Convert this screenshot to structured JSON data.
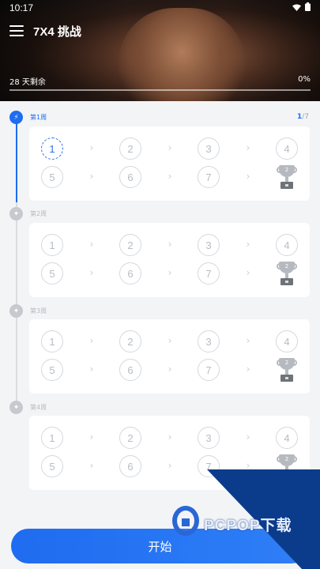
{
  "status_bar": {
    "time": "10:17"
  },
  "app": {
    "title": "7X4 挑战"
  },
  "hero": {
    "days_left": "28 天剩余",
    "progress_text": "0%",
    "progress_value": 0
  },
  "week_counter": {
    "current": "1",
    "total": "/7"
  },
  "weeks": [
    {
      "label": "第1周",
      "days": [
        "1",
        "2",
        "3",
        "4",
        "5",
        "6",
        "7"
      ],
      "active": true
    },
    {
      "label": "第2周",
      "days": [
        "1",
        "2",
        "3",
        "4",
        "5",
        "6",
        "7"
      ],
      "active": false
    },
    {
      "label": "第3周",
      "days": [
        "1",
        "2",
        "3",
        "4",
        "5",
        "6",
        "7"
      ],
      "active": false
    },
    {
      "label": "第4周",
      "days": [
        "1",
        "2",
        "3",
        "4",
        "5",
        "6",
        "7"
      ],
      "active": false
    }
  ],
  "arrow_glyph": "›",
  "trophy_text": "2",
  "start_button": "开始",
  "watermark": {
    "text": "PCPOP下载"
  },
  "colors": {
    "accent": "#1f6cf0",
    "inactive": "#c6c9ce",
    "watermark": "#0b3c8c"
  }
}
